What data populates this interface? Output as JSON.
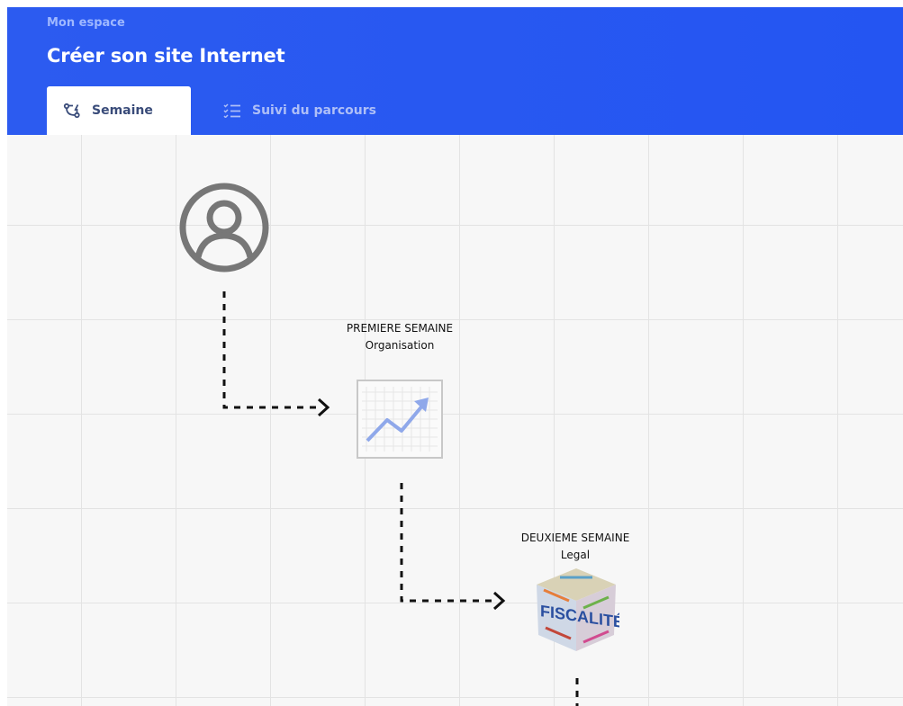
{
  "header": {
    "breadcrumb": "Mon espace",
    "title": "Créer son site Internet",
    "tabs": [
      {
        "label": "Semaine",
        "icon": "network-icon",
        "active": true
      },
      {
        "label": "Suivi du parcours",
        "icon": "checklist-icon",
        "active": false
      }
    ]
  },
  "workflow": {
    "start_icon": "user-circle-icon",
    "steps": [
      {
        "title": "PREMIERE SEMAINE",
        "subtitle": "Organisation",
        "icon": "line-chart-icon"
      },
      {
        "title": "DEUXIEME SEMAINE",
        "subtitle": "Legal",
        "icon": "fiscalite-cube-icon",
        "image_text": "FISCALITÉ"
      }
    ]
  },
  "colors": {
    "header_blue": "#2c5bf0",
    "tab_active_text": "#3a4c7a",
    "tab_inactive_text": "#aebff7",
    "grid_line": "#e3e3e3"
  }
}
